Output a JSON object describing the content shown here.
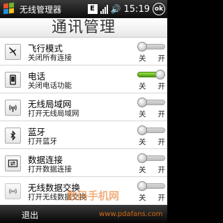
{
  "status_bar": {
    "app_title": "无线管理器",
    "e_badge": "E",
    "time": "15:19",
    "ok_label": "ok"
  },
  "header": {
    "title": "通讯管理"
  },
  "items": [
    {
      "title": "飞行模式",
      "subtitle": "关闭所有连接",
      "icon": "airplane-icon",
      "state": "off"
    },
    {
      "title": "电话",
      "subtitle": "关闭电话功能",
      "icon": "phone-icon",
      "state": "on"
    },
    {
      "title": "无线局域网",
      "subtitle": "打开无线局域网",
      "icon": "wifi-icon",
      "state": "off"
    },
    {
      "title": "蓝牙",
      "subtitle": "打开蓝牙",
      "icon": "bluetooth-icon",
      "state": "off"
    },
    {
      "title": "数据连接",
      "subtitle": "打开数据连接",
      "icon": "data-connection-icon",
      "state": "off"
    },
    {
      "title": "无线数据交换",
      "subtitle": "打开无线数据交换",
      "icon": "infrared-beam-icon",
      "state": "off"
    }
  ],
  "toggle_labels": {
    "off": "关",
    "on": "开"
  },
  "softkeys": {
    "left": "退出"
  },
  "watermark": {
    "text": "数码手机网",
    "url": "www.pdafans.com"
  },
  "colors": {
    "toggle_on": "#5cb01a",
    "header_bg": "#f0f0f0"
  }
}
